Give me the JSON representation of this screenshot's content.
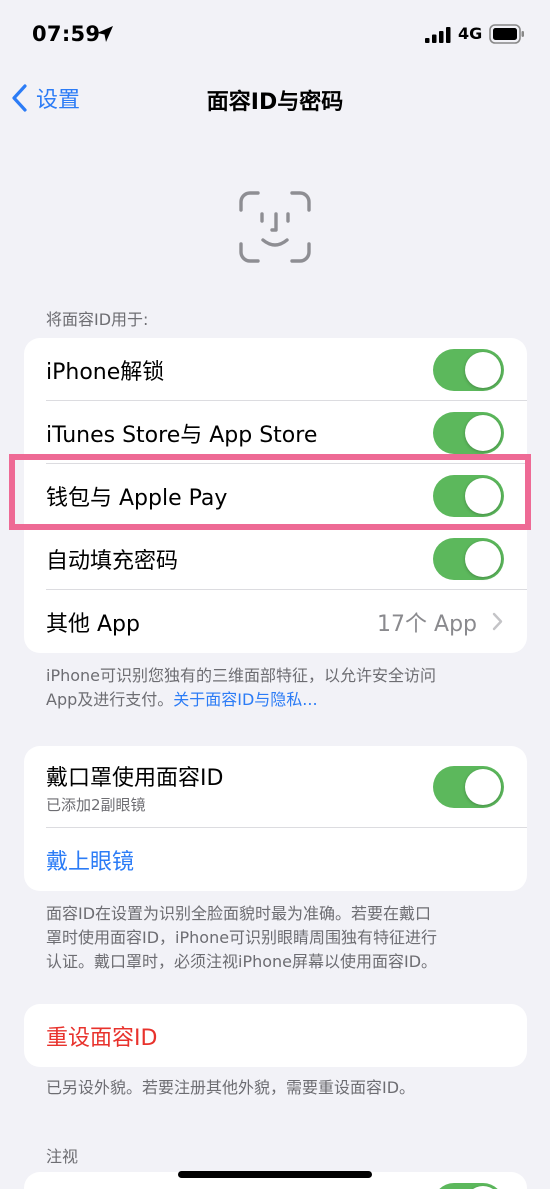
{
  "status": {
    "time": "07:59",
    "network": "4G"
  },
  "nav": {
    "back_label": "设置",
    "title": "面容ID与密码"
  },
  "use_for": {
    "header": "将面容ID用于:",
    "rows": [
      {
        "label": "iPhone解锁",
        "on": true
      },
      {
        "label": "iTunes Store与 App Store",
        "on": true
      },
      {
        "label": "钱包与 Apple Pay",
        "on": true
      },
      {
        "label": "自动填充密码",
        "on": true
      },
      {
        "label": "其他 App",
        "value": "17个 App"
      }
    ],
    "footer_line1": "iPhone可识别您独有的三维面部特征，以允许安全访问",
    "footer_line2": "App及进行支付。",
    "footer_link": "关于面容ID与隐私..."
  },
  "mask": {
    "title": "戴口罩使用面容ID",
    "subtitle": "已添加2副眼镜",
    "on": true,
    "glasses_link": "戴上眼镜",
    "footer_line1": "面容ID在设置为识别全脸面貌时最为准确。若要在戴口",
    "footer_line2": "罩时使用面容ID，iPhone可识别眼睛周围独有特征进行",
    "footer_line3": "认证。戴口罩时，必须注视iPhone屏幕以使用面容ID。"
  },
  "reset": {
    "label": "重设面容ID",
    "footer": "已另设外貌。若要注册其他外貌，需要重设面容ID。"
  },
  "attention": {
    "header": "注视"
  },
  "colors": {
    "toggle_on": "#5cb85c",
    "link": "#2c7cf6",
    "destructive": "#e8322c",
    "highlight": "#ee6a95"
  }
}
